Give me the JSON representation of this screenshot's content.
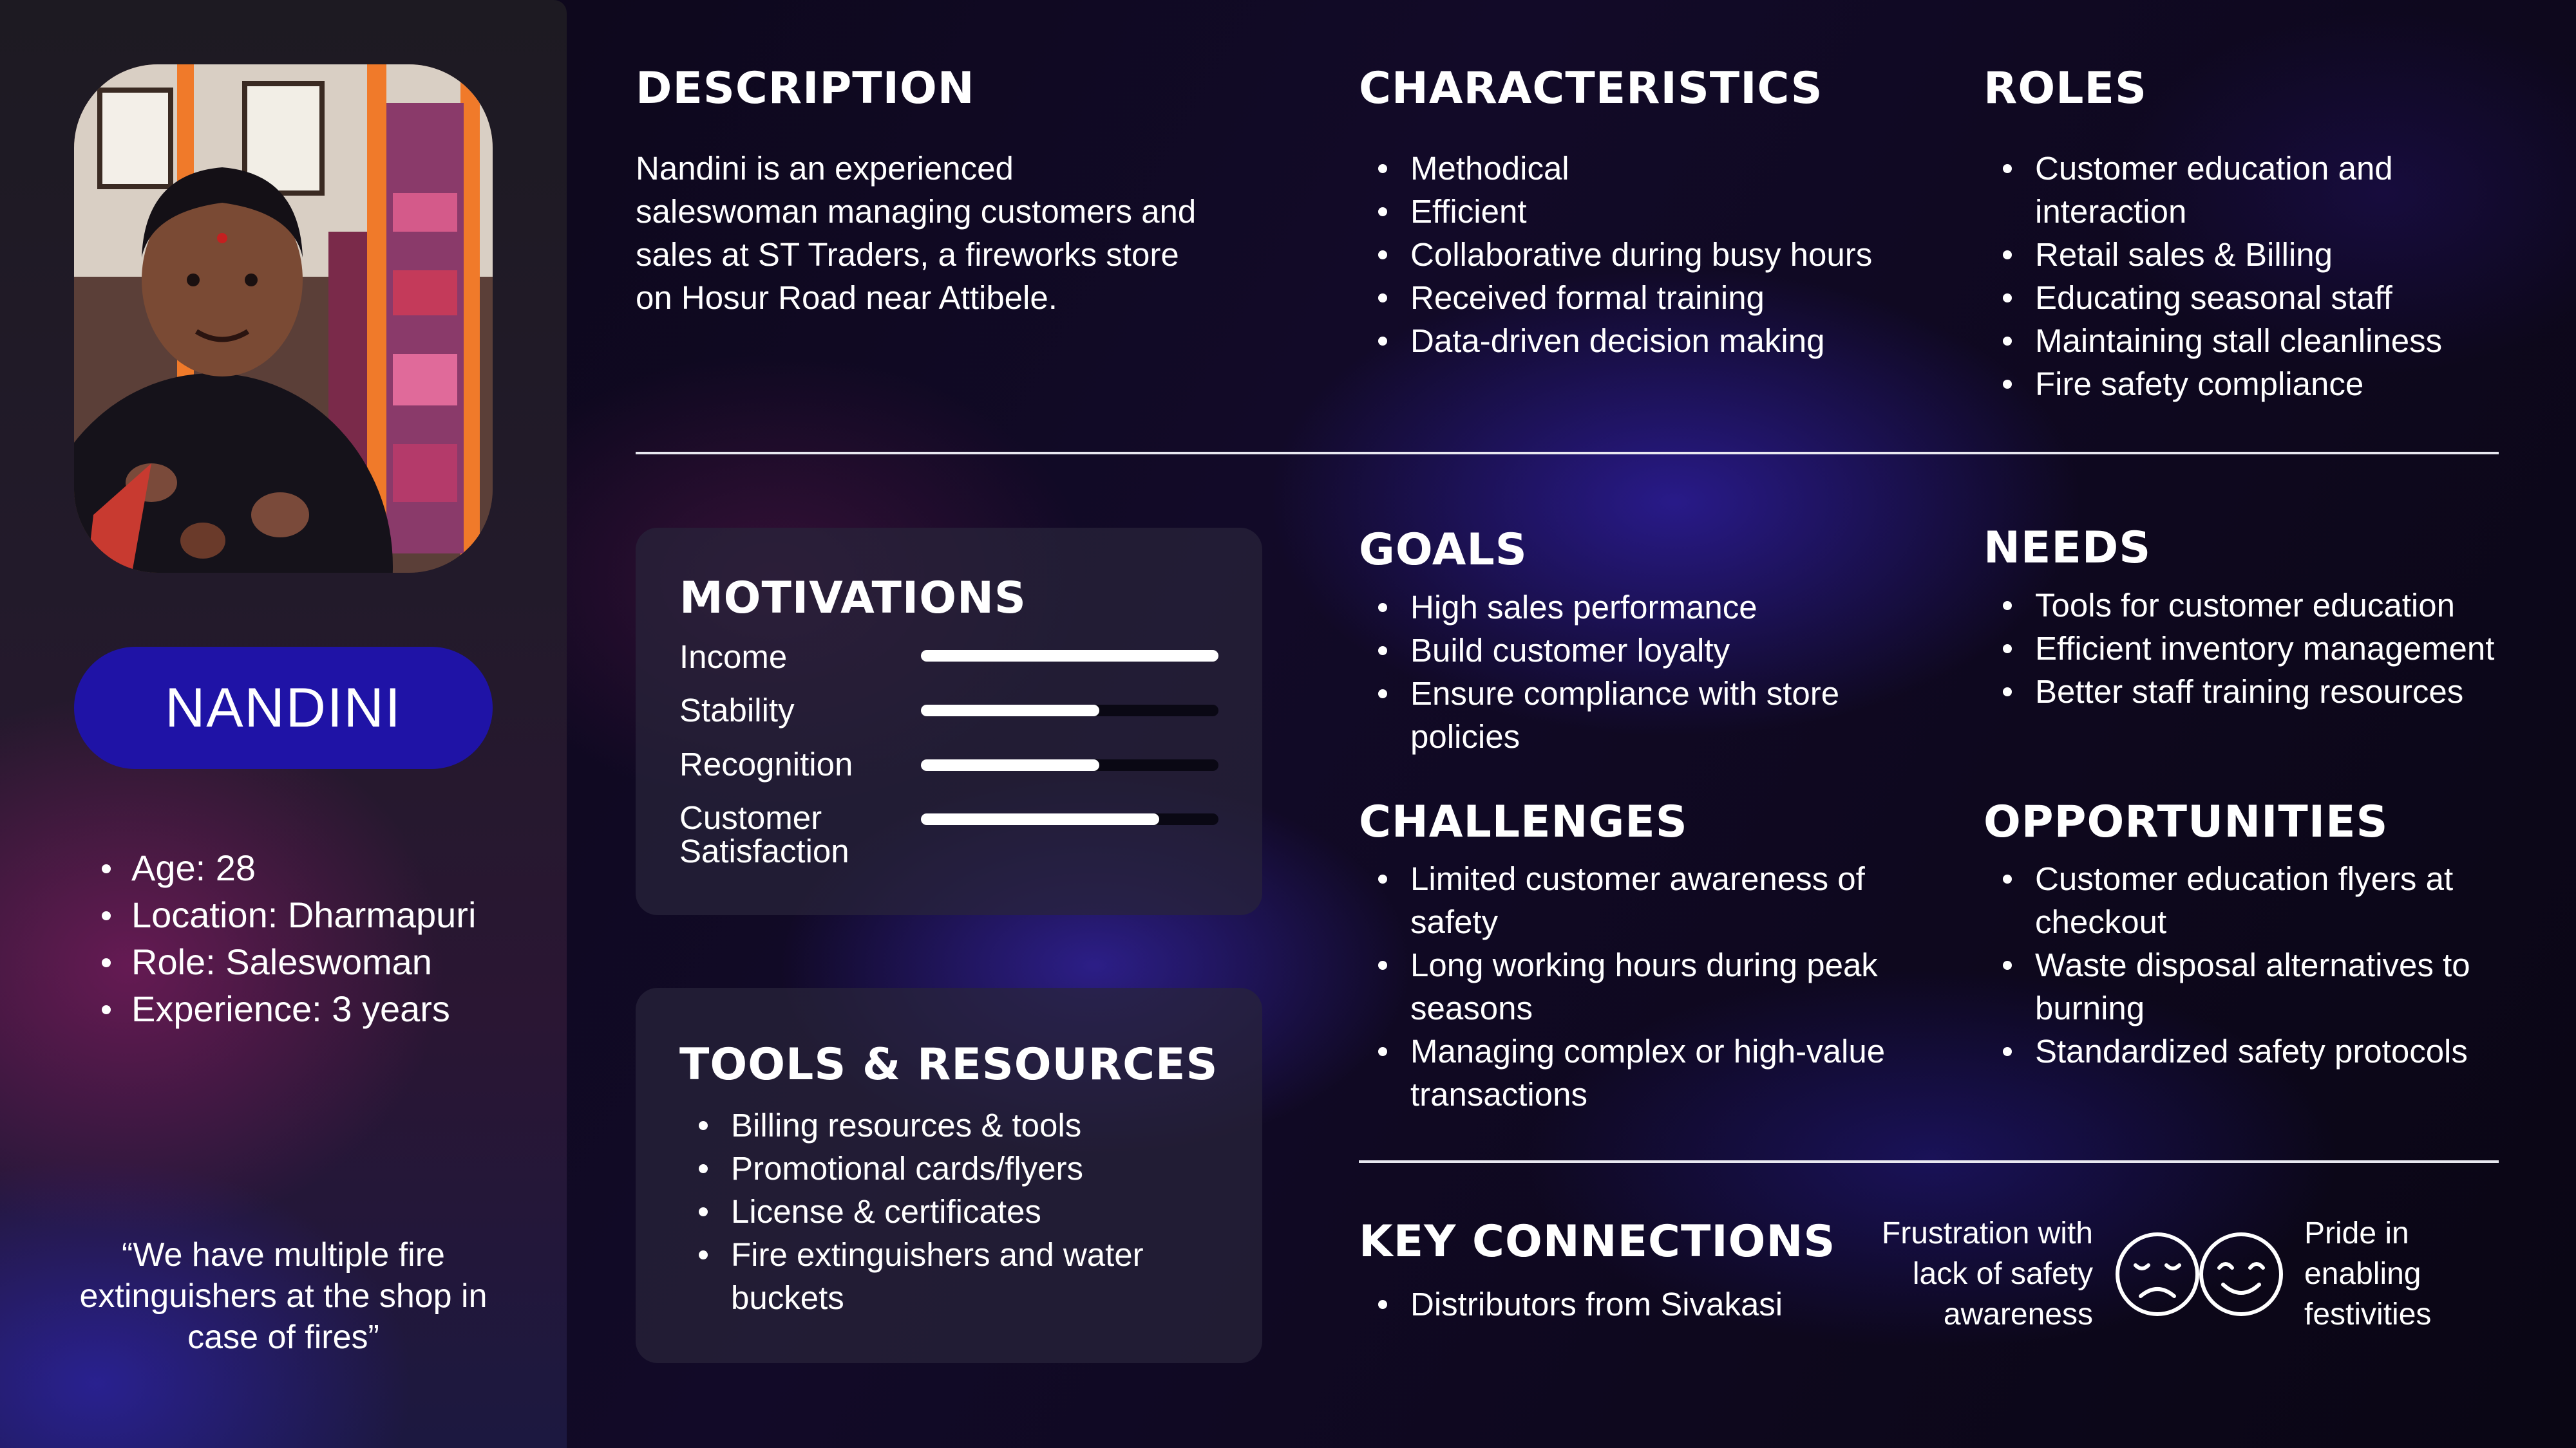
{
  "profile": {
    "name": "NANDINI",
    "facts": [
      "Age: 28",
      "Location: Dharmapuri",
      "Role: Saleswoman",
      "Experience: 3 years"
    ],
    "quote": "“We have multiple fire extinguishers at the shop in case of fires”"
  },
  "description": {
    "heading": "DESCRIPTION",
    "text": "Nandini is an experienced saleswoman managing customers and sales at ST Traders, a fireworks store on Hosur Road near Attibele."
  },
  "characteristics": {
    "heading": "CHARACTERISTICS",
    "items": [
      "Methodical",
      "Efficient",
      "Collaborative during busy hours",
      "Received formal training",
      "Data-driven decision making"
    ]
  },
  "roles": {
    "heading": "ROLES",
    "items": [
      "Customer education and interaction",
      "Retail sales & Billing",
      "Educating seasonal staff",
      "Maintaining stall cleanliness",
      "Fire safety compliance"
    ]
  },
  "motivations": {
    "heading": "MOTIVATIONS",
    "items": [
      {
        "label": "Income",
        "level": 1.0
      },
      {
        "label": "Stability",
        "level": 0.6
      },
      {
        "label": "Recognition",
        "level": 0.6
      },
      {
        "label": "Customer Satisfaction",
        "level": 0.8
      }
    ]
  },
  "tools": {
    "heading": "TOOLS & RESOURCES",
    "items": [
      "Billing resources & tools",
      "Promotional cards/flyers",
      "License & certificates",
      "Fire extinguishers and water buckets"
    ]
  },
  "goals": {
    "heading": "GOALS",
    "items": [
      "High sales performance",
      "Build customer loyalty",
      "Ensure compliance with store policies"
    ]
  },
  "needs": {
    "heading": "NEEDS",
    "items": [
      "Tools for customer education",
      "Efficient inventory management",
      "Better staff training resources"
    ]
  },
  "challenges": {
    "heading": "CHALLENGES",
    "items": [
      "Limited customer awareness of safety",
      "Long working hours during peak seasons",
      "Managing complex or high-value transactions"
    ]
  },
  "opportunities": {
    "heading": "OPPORTUNITIES",
    "items": [
      "Customer education flyers at checkout",
      "Waste disposal alternatives to burning",
      "Standardized safety protocols"
    ]
  },
  "key_connections": {
    "heading": "KEY CONNECTIONS",
    "items": [
      "Distributors from Sivakasi"
    ],
    "frustration": "Frustration with lack of safety awareness",
    "pride": "Pride in enabling festivities",
    "frustration_icon": "sad-face-icon",
    "pride_icon": "happy-face-icon"
  },
  "colors": {
    "accent": "#1f13a6",
    "text": "#ffffff"
  }
}
